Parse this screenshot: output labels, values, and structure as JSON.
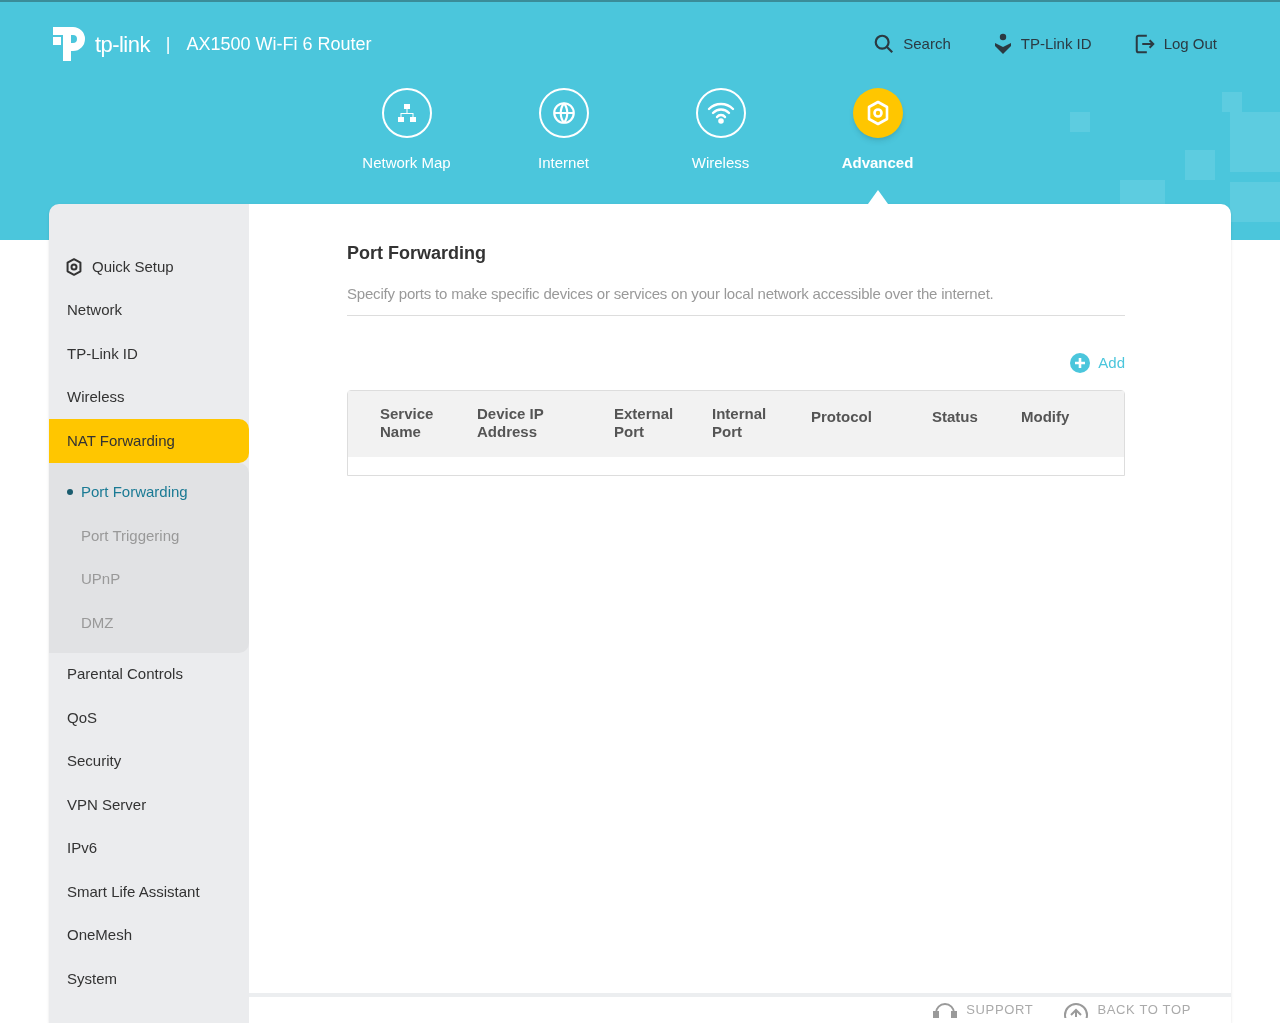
{
  "brand": {
    "logo": "tp-link",
    "separator": "|",
    "model": "AX1500 Wi-Fi 6 Router"
  },
  "header_links": [
    {
      "kind": "search",
      "label": "Search"
    },
    {
      "kind": "account",
      "label": "TP-Link ID"
    },
    {
      "kind": "logout",
      "label": "Log Out"
    }
  ],
  "nav_tabs": [
    {
      "kind": "map",
      "label": "Network Map",
      "selected": false
    },
    {
      "kind": "internet",
      "label": "Internet",
      "selected": false
    },
    {
      "kind": "wireless",
      "label": "Wireless",
      "selected": false
    },
    {
      "kind": "advanced",
      "label": "Advanced",
      "selected": true
    }
  ],
  "sidebar": {
    "items": [
      {
        "label": "Quick Setup",
        "kind": "setup",
        "selected": false
      },
      {
        "label": "Network",
        "kind": "item",
        "selected": false
      },
      {
        "label": "TP-Link ID",
        "kind": "item",
        "selected": false
      },
      {
        "label": "Wireless",
        "kind": "item",
        "selected": false
      },
      {
        "label": "NAT Forwarding",
        "kind": "item",
        "selected": true,
        "expanded": true,
        "children": [
          {
            "label": "Port Forwarding",
            "selected": true
          },
          {
            "label": "Port Triggering",
            "selected": false
          },
          {
            "label": "UPnP",
            "selected": false
          },
          {
            "label": "DMZ",
            "selected": false
          }
        ]
      },
      {
        "label": "Parental Controls",
        "kind": "item",
        "selected": false
      },
      {
        "label": "QoS",
        "kind": "item",
        "selected": false
      },
      {
        "label": "Security",
        "kind": "item",
        "selected": false
      },
      {
        "label": "VPN Server",
        "kind": "item",
        "selected": false
      },
      {
        "label": "IPv6",
        "kind": "item",
        "selected": false
      },
      {
        "label": "Smart Life Assistant",
        "kind": "item",
        "selected": false
      },
      {
        "label": "OneMesh",
        "kind": "item",
        "selected": false
      },
      {
        "label": "System",
        "kind": "item",
        "selected": false
      }
    ]
  },
  "content": {
    "title": "Port Forwarding",
    "description": "Specify ports to make specific devices or services on your local network accessible over the internet.",
    "add_button": "Add",
    "table": {
      "columns": [
        "Service Name",
        "Device IP Address",
        "External Port",
        "Internal Port",
        "Protocol",
        "Status",
        "Modify"
      ]
    }
  },
  "footer": {
    "links": [
      {
        "kind": "support",
        "label": "SUPPORT"
      },
      {
        "kind": "top",
        "label": "BACK TO TOP"
      }
    ]
  }
}
